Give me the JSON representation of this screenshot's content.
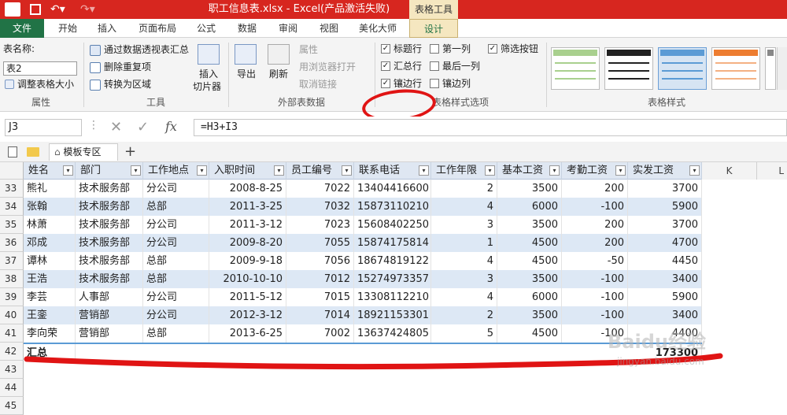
{
  "titlebar": {
    "app_icon": "X",
    "title": "职工信息表.xlsx - Excel(产品激活失败)",
    "context_group": "表格工具"
  },
  "tabs": [
    "文件",
    "开始",
    "插入",
    "页面布局",
    "公式",
    "数据",
    "审阅",
    "视图",
    "美化大师",
    "设计"
  ],
  "ribbon": {
    "properties": {
      "table_name_label": "表名称:",
      "table_name_value": "表2",
      "resize_label": "调整表格大小",
      "group": "属性"
    },
    "tools": {
      "pivot": "通过数据透视表汇总",
      "remove_dup": "删除重复项",
      "convert_range": "转换为区域",
      "insert_slicer_1": "插入",
      "insert_slicer_2": "切片器",
      "group": "工具"
    },
    "external": {
      "export": "导出",
      "refresh": "刷新",
      "properties": "属性",
      "open_browser": "用浏览器打开",
      "unlink": "取消链接",
      "group": "外部表数据"
    },
    "style_options": {
      "header_row": "标题行",
      "total_row": "汇总行",
      "banded_rows": "镶边行",
      "first_col": "第一列",
      "last_col": "最后一列",
      "banded_cols": "镶边列",
      "filter_btn": "筛选按钮",
      "group": "表格样式选项"
    },
    "styles_group": "表格样式"
  },
  "formula_bar": {
    "name_box": "J3",
    "formula": "=H3+I3"
  },
  "doc_tabs": {
    "template_zone": "模板专区",
    "add": "+"
  },
  "grid": {
    "headers": [
      "姓名",
      "部门",
      "工作地点",
      "入职时间",
      "员工编号",
      "联系电话",
      "工作年限",
      "基本工资",
      "考勤工资",
      "实发工资"
    ],
    "extra_cols": [
      "K",
      "L"
    ],
    "rows": [
      {
        "n": "33",
        "c": [
          "熊礼",
          "技术服务部",
          "分公司",
          "2008-8-25",
          "7022",
          "13404416600",
          "2",
          "3500",
          "200",
          "3700"
        ]
      },
      {
        "n": "34",
        "c": [
          "张翰",
          "技术服务部",
          "总部",
          "2011-3-25",
          "7032",
          "15873110210",
          "4",
          "6000",
          "-100",
          "5900"
        ]
      },
      {
        "n": "35",
        "c": [
          "林萧",
          "技术服务部",
          "分公司",
          "2011-3-12",
          "7023",
          "15608402250",
          "3",
          "3500",
          "200",
          "3700"
        ]
      },
      {
        "n": "36",
        "c": [
          "邓成",
          "技术服务部",
          "分公司",
          "2009-8-20",
          "7055",
          "15874175814",
          "1",
          "4500",
          "200",
          "4700"
        ]
      },
      {
        "n": "37",
        "c": [
          "谭林",
          "技术服务部",
          "总部",
          "2009-9-18",
          "7056",
          "18674819122",
          "4",
          "4500",
          "-50",
          "4450"
        ]
      },
      {
        "n": "38",
        "c": [
          "王浩",
          "技术服务部",
          "总部",
          "2010-10-10",
          "7012",
          "15274973357",
          "3",
          "3500",
          "-100",
          "3400"
        ]
      },
      {
        "n": "39",
        "c": [
          "李芸",
          "人事部",
          "分公司",
          "2011-5-12",
          "7015",
          "13308112210",
          "4",
          "6000",
          "-100",
          "5900"
        ]
      },
      {
        "n": "40",
        "c": [
          "王銮",
          "营销部",
          "分公司",
          "2012-3-12",
          "7014",
          "18921153301",
          "2",
          "3500",
          "-100",
          "3400"
        ]
      },
      {
        "n": "41",
        "c": [
          "李向荣",
          "营销部",
          "总部",
          "2013-6-25",
          "7002",
          "13637424805",
          "5",
          "4500",
          "-100",
          "4400"
        ]
      }
    ],
    "total_row": {
      "n": "42",
      "label": "汇总",
      "sum": "173300"
    },
    "empty_rows": [
      "43",
      "44",
      "45"
    ]
  },
  "watermark": {
    "main": "Baidu经验",
    "sub": "jingyan.baidu.com"
  },
  "colors": {
    "excel_green": "#217346",
    "title_red": "#d7261f",
    "band": "#dde8f5",
    "annotation": "#e01414"
  }
}
